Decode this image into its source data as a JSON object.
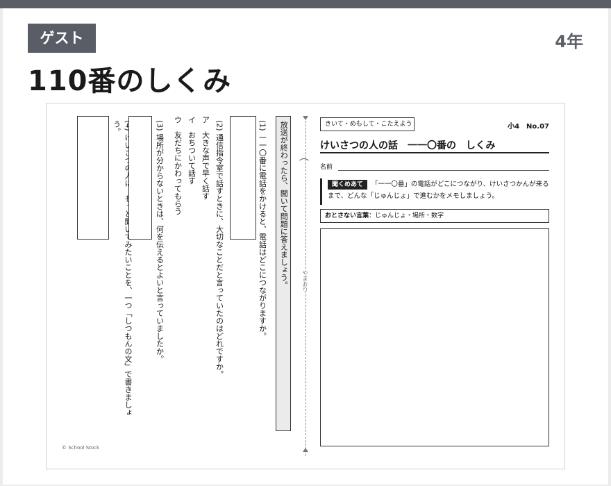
{
  "header": {
    "badge": "ゲスト",
    "grade": "4年",
    "title": "110番のしくみ"
  },
  "worksheet": {
    "instruction_box": "きいて・めもして・こたえよう",
    "number": "小4　No.07",
    "title": "けいさつの人の話　一一〇番の　しくみ",
    "name_label": "名前",
    "listen_tag": "聞くめあて",
    "listen_text": "「一一〇番」の電話がどこにつながり、けいさつかんが来るまで、どんな「じゅんじょ」で進むかをメモしましょう。",
    "keywords_label": "おとさない言葉",
    "keywords_text": "：じゅんじょ・場所・数字",
    "fold_label": "やまおり",
    "fold_mark": "⌒",
    "questions_title": "放送が終わったら、聞いて問題に答えましょう。",
    "q1": "(1) 一一〇番に電話をかけると、電話はどこにつながりますか。",
    "q2": "(2) 通信指令室で話すときに、大切なことだと言っていたのはどれですか。",
    "q2_a": "ア　大きな声で早く話す",
    "q2_i": "イ　おちついて話す",
    "q2_u": "ウ　友だちにかわってもらう",
    "q3": "(3) 場所が分からないときは、何を伝えるとよいと言っていましたか。",
    "q4": "(4) けいさつの人に、もっと聞いてみたいことを、一つ「しつもんの文」で書きましょう。",
    "copyright": "© School Stock"
  }
}
